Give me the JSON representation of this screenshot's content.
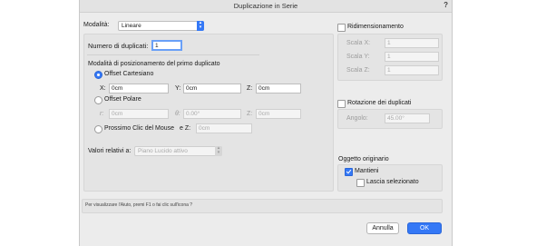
{
  "window": {
    "title": "Duplicazione in Serie",
    "help_icon": "?"
  },
  "mode": {
    "label": "Modalità:",
    "value": "Lineare"
  },
  "count": {
    "label": "Numero di duplicati:",
    "value": "1"
  },
  "positioning": {
    "heading": "Modalità di posizionamento del primo duplicato",
    "cartesian": {
      "label": "Offset Cartesiano",
      "selected": true,
      "x_label": "X:",
      "x_value": "0cm",
      "y_label": "Y:",
      "y_value": "0cm",
      "z_label": "Z:",
      "z_value": "0cm"
    },
    "polar": {
      "label": "Offset Polare",
      "selected": false,
      "r_label": "r:",
      "r_value": "0cm",
      "theta_label": "θ:",
      "theta_value": "0.00°",
      "z_label": "Z:",
      "z_value": "0cm"
    },
    "mouse": {
      "label": "Prossimo Clic del Mouse",
      "selected": false,
      "z_label": "e Z:",
      "z_value": "0cm"
    }
  },
  "relative": {
    "label": "Valori relativi a:",
    "value": "Piano Lucido attivo"
  },
  "resize": {
    "label": "Ridimensionamento",
    "checked": false,
    "x_label": "Scala X:",
    "x_value": "1",
    "y_label": "Scala Y:",
    "y_value": "1",
    "z_label": "Scala Z:",
    "z_value": "1"
  },
  "rotation": {
    "label": "Rotazione dei duplicati",
    "checked": false,
    "angle_label": "Angolo:",
    "angle_value": "45.00°"
  },
  "original": {
    "heading": "Oggetto originario",
    "keep_label": "Mantieni",
    "keep_checked": true,
    "leave_label": "Lascia selezionato",
    "leave_checked": false
  },
  "help_text": "Per visualizzare l'Aiuto, premi F1 o fai clic sull'icona ?",
  "buttons": {
    "cancel": "Annulla",
    "ok": "OK"
  }
}
